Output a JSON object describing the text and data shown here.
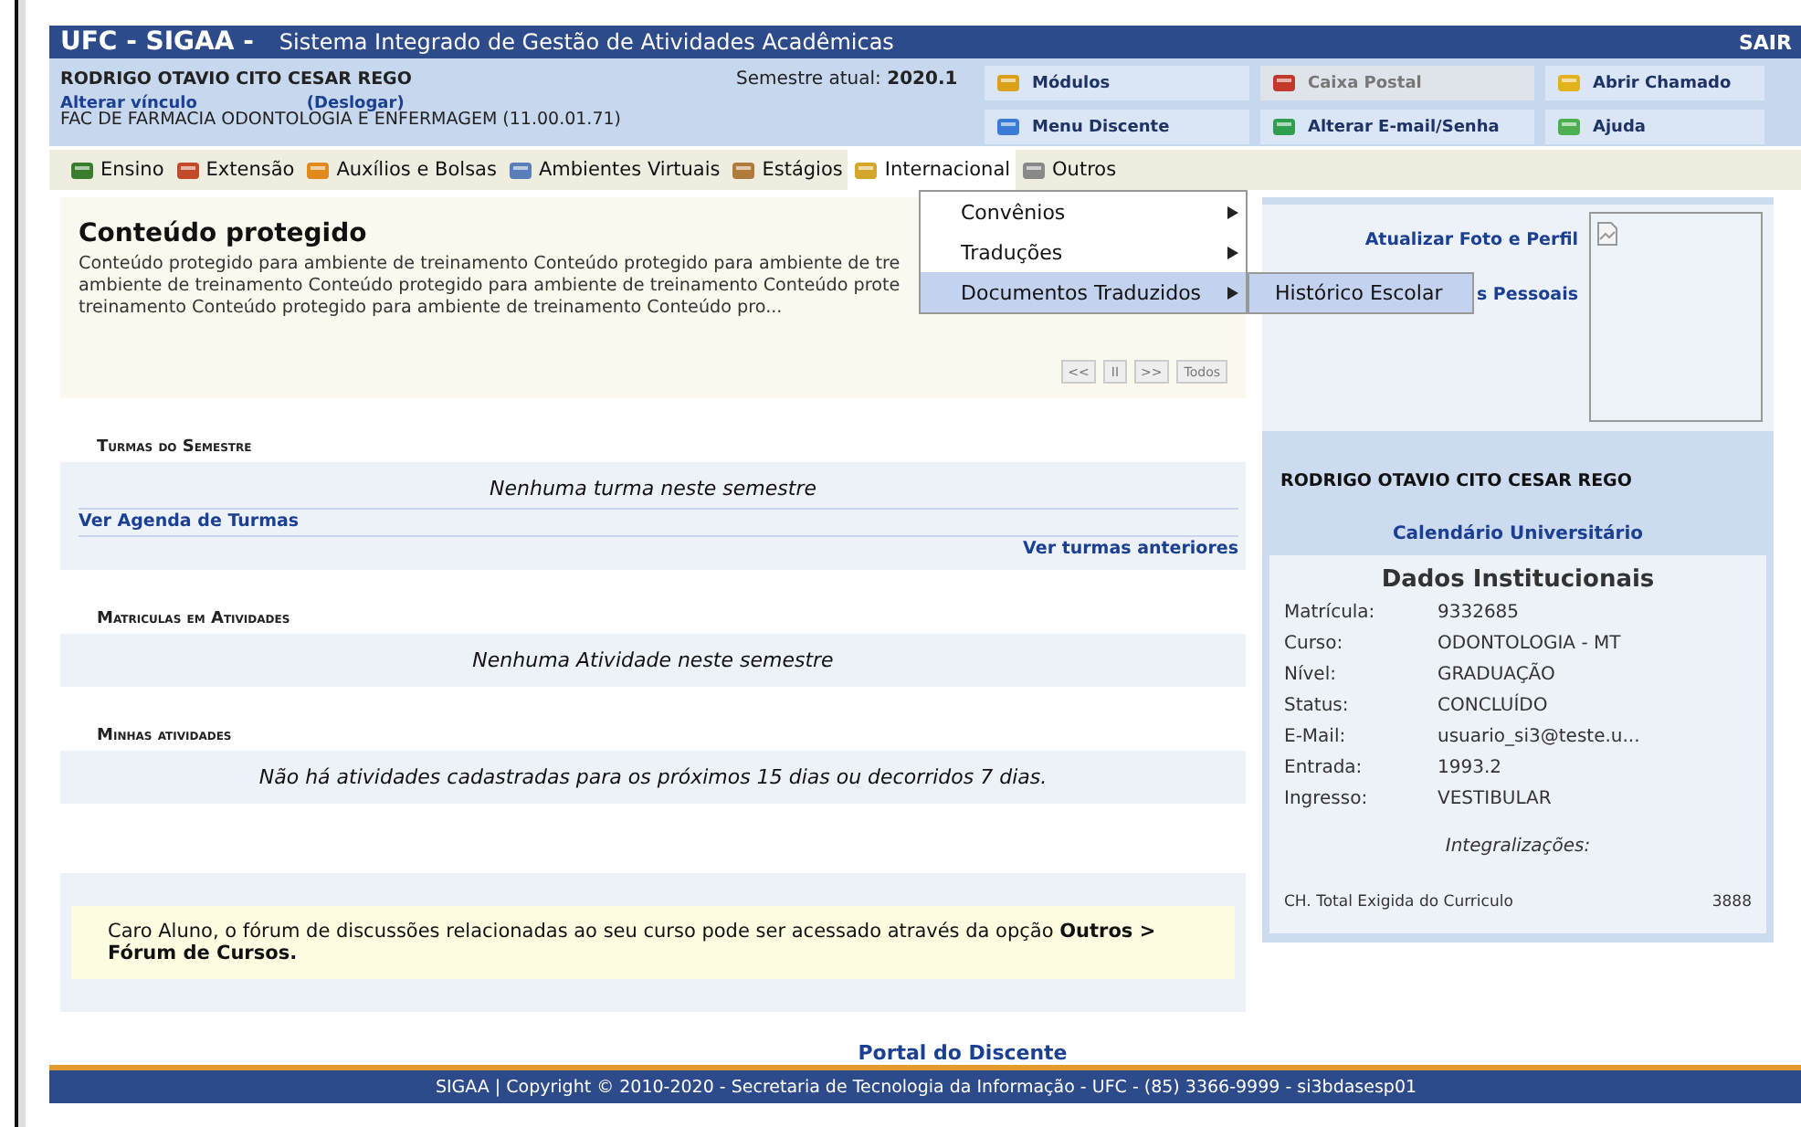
{
  "header": {
    "logo": "UFC - SIGAA -",
    "title": "Sistema Integrado de Gestão de Atividades Acadêmicas",
    "logout": "SAIR"
  },
  "user": {
    "name": "RODRIGO OTAVIO CITO CESAR REGO",
    "links": [
      "Alterar vínculo",
      "(Deslogar)"
    ],
    "unit": "FAC DE FARMACIA ODONTOLOGIA E ENFERMAGEM (11.00.01.71)",
    "semester_label": "Semestre atual:",
    "semester": "2020.1"
  },
  "shortcuts": [
    {
      "label": "Módulos",
      "disabled": false
    },
    {
      "label": "Caixa Postal",
      "disabled": true
    },
    {
      "label": "Abrir Chamado",
      "disabled": false
    },
    {
      "label": "Menu Discente",
      "disabled": false
    },
    {
      "label": "Alterar E-mail/Senha",
      "disabled": false
    },
    {
      "label": "Ajuda",
      "disabled": false
    }
  ],
  "menu": [
    {
      "label": "Ensino",
      "selected": false
    },
    {
      "label": "Extensão",
      "selected": false
    },
    {
      "label": "Auxílios e Bolsas",
      "selected": false
    },
    {
      "label": "Ambientes Virtuais",
      "selected": false
    },
    {
      "label": "Estágios",
      "selected": false
    },
    {
      "label": "Internacional",
      "selected": true
    },
    {
      "label": "Outros",
      "selected": false
    }
  ],
  "dropdown": [
    {
      "label": "Convênios",
      "selected": false
    },
    {
      "label": "Traduções",
      "selected": false
    },
    {
      "label": "Documentos Traduzidos",
      "selected": true
    }
  ],
  "submenu": [
    {
      "label": "Histórico Escolar",
      "selected": true
    }
  ],
  "notice": {
    "title": "Conteúdo protegido",
    "lines": [
      "Conteúdo protegido para ambiente de treinamento Conteúdo protegido para ambiente de tre",
      "ambiente de treinamento Conteúdo protegido para ambiente de treinamento Conteúdo prote",
      "treinamento Conteúdo protegido para ambiente de treinamento Conteúdo pro..."
    ],
    "pager": [
      "<<",
      "II",
      ">>",
      "Todos"
    ]
  },
  "sections": [
    {
      "title": "Turmas do Semestre",
      "message": "Nenhuma turma neste semestre",
      "link_left": "Ver Agenda de Turmas",
      "link_right": "Ver turmas anteriores"
    },
    {
      "title": "Matriculas em Atividades",
      "message": "Nenhuma Atividade neste semestre"
    },
    {
      "title": "Minhas atividades",
      "message": "Não há atividades cadastradas para os próximos 15 dias ou decorridos 7 dias."
    }
  ],
  "forum": "Caro Aluno, o fórum de discussões relacionadas ao seu curso pode ser acessado através da opção **Outros > Fórum de Cursos.**",
  "profile": {
    "photo_link": "Atualizar Foto e Perfil",
    "data_link": "s Pessoais",
    "name": "RODRIGO OTAVIO CITO CESAR REGO",
    "calendar": "Calendário Universitário"
  },
  "institutional": {
    "title": "Dados Institucionais",
    "rows": [
      {
        "label": "Matrícula:",
        "value": "9332685"
      },
      {
        "label": "Curso:",
        "value": "ODONTOLOGIA - MT"
      },
      {
        "label": "Nível:",
        "value": "GRADUAÇÃO"
      },
      {
        "label": "Status:",
        "value": "CONCLUÍDO"
      },
      {
        "label": "E-Mail:",
        "value": "usuario_si3@teste.u..."
      },
      {
        "label": "Entrada:",
        "value": "1993.2"
      },
      {
        "label": "Ingresso:",
        "value": "VESTIBULAR"
      }
    ],
    "subtitle": "Integralizações:",
    "total_label": "CH. Total Exigida do Curriculo",
    "total_value": "3888"
  },
  "portal": "Portal do Discente",
  "footer": "SIGAA | Copyright © 2010-2020 - Secretaria de Tecnologia da Informação - UFC - (85) 3366-9999 - si3bdasesp01"
}
